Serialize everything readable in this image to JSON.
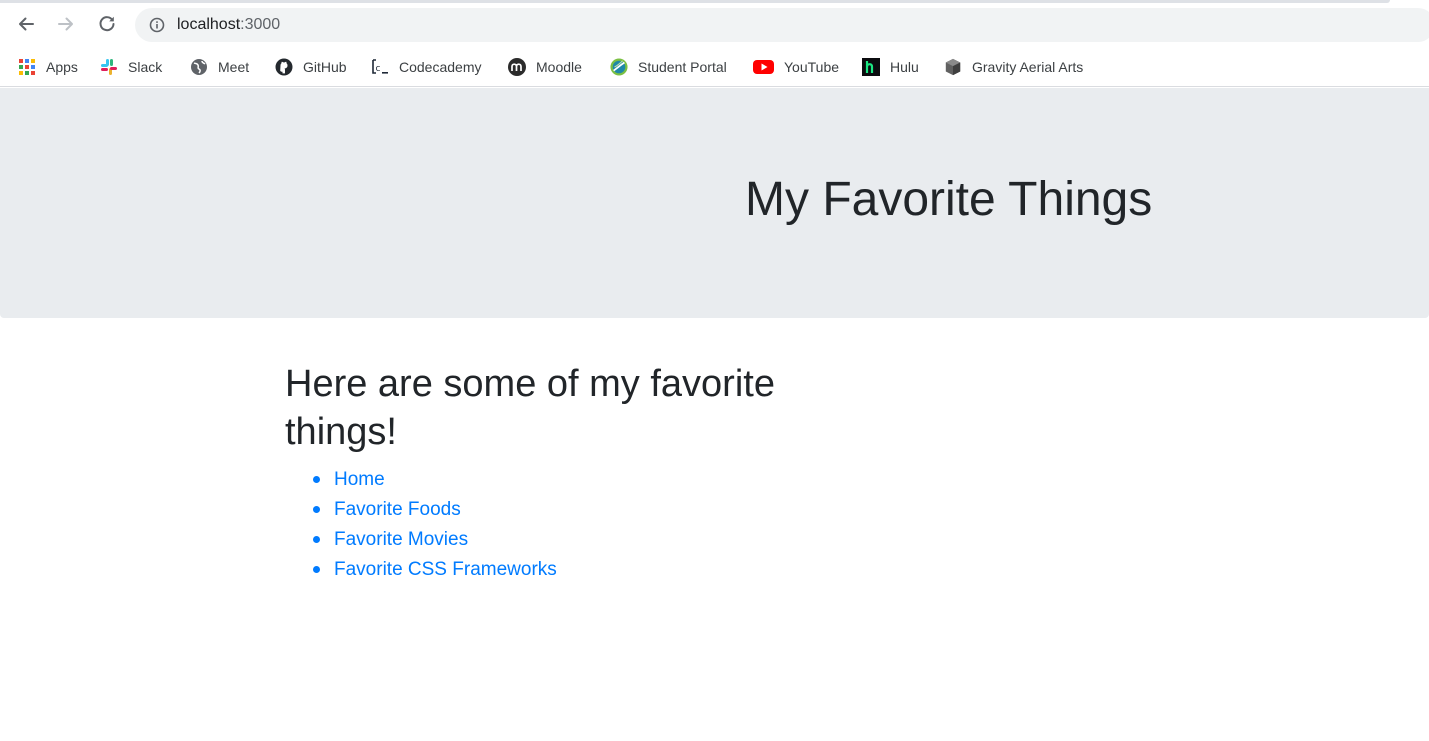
{
  "browser": {
    "url_host": "localhost",
    "url_port": ":3000",
    "icons": {
      "back": "arrow-left-icon",
      "forward": "arrow-right-icon",
      "reload": "reload-icon",
      "site_info": "info-circle-icon"
    }
  },
  "bookmarks": [
    {
      "label": "Apps",
      "icon": "apps-grid-icon"
    },
    {
      "label": "Slack",
      "icon": "slack-icon"
    },
    {
      "label": "Meet",
      "icon": "globe-icon"
    },
    {
      "label": "GitHub",
      "icon": "github-icon"
    },
    {
      "label": "Codecademy",
      "icon": "codecademy-icon"
    },
    {
      "label": "Moodle",
      "icon": "moodle-icon"
    },
    {
      "label": "Student Portal",
      "icon": "student-portal-icon"
    },
    {
      "label": "YouTube",
      "icon": "youtube-icon"
    },
    {
      "label": "Hulu",
      "icon": "hulu-icon"
    },
    {
      "label": "Gravity Aerial Arts",
      "icon": "cube-icon"
    }
  ],
  "page": {
    "jumbotron_title": "My Favorite Things",
    "heading": "Here are some of my favorite things!",
    "links": [
      {
        "label": "Home"
      },
      {
        "label": "Favorite Foods"
      },
      {
        "label": "Favorite Movies"
      },
      {
        "label": "Favorite CSS Frameworks"
      }
    ]
  },
  "colors": {
    "link": "#007bff",
    "jumbotron_bg": "#e9ecef",
    "text": "#212529"
  }
}
